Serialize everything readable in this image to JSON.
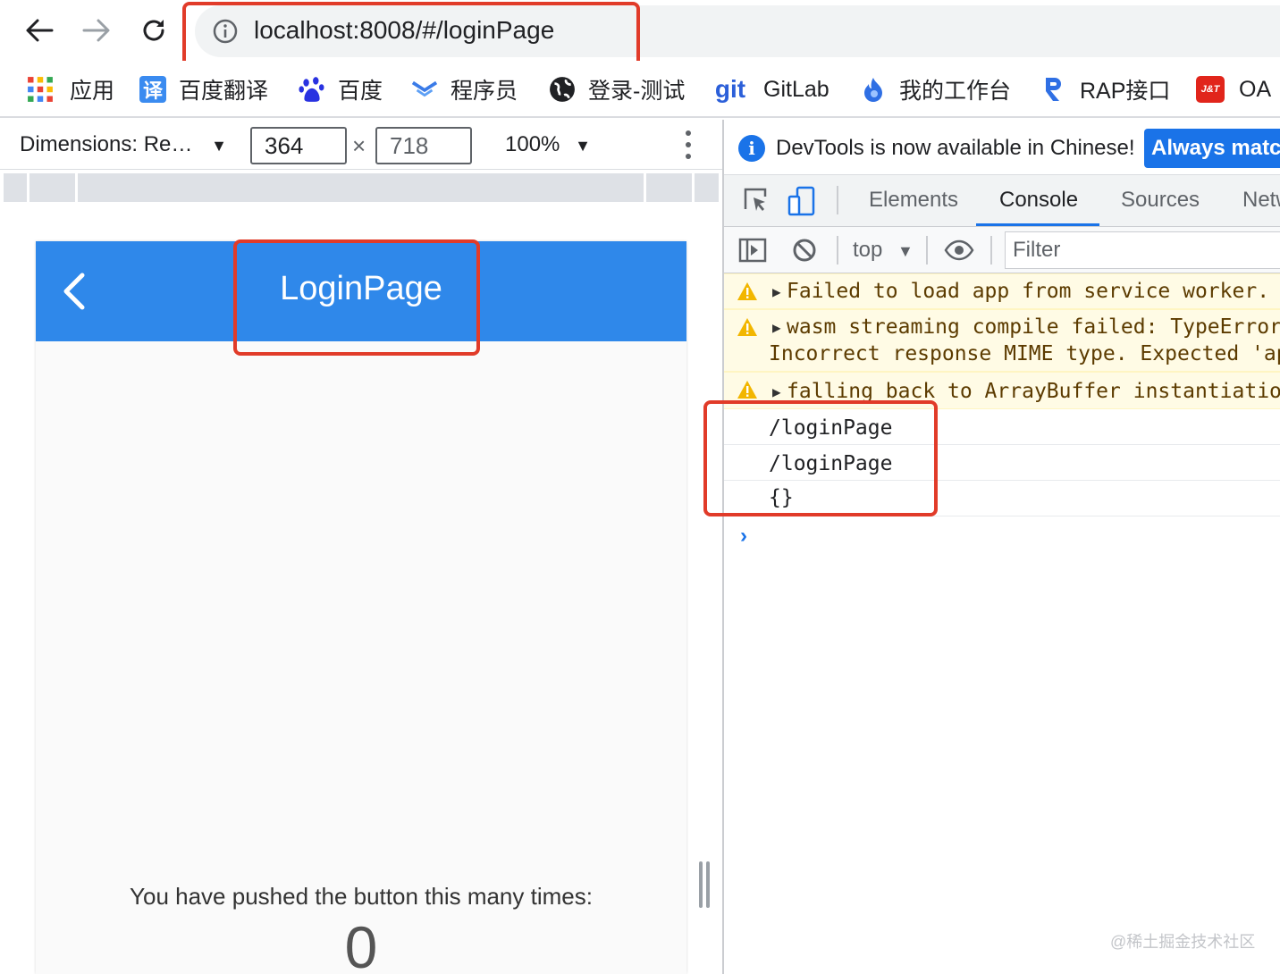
{
  "browser": {
    "url": "localhost:8008/#/loginPage"
  },
  "bookmarks": [
    {
      "label": "应用",
      "icon": "apps-grid-icon"
    },
    {
      "label": "百度翻译",
      "icon": "baidu-translate-icon"
    },
    {
      "label": "百度",
      "icon": "baidu-paw-icon"
    },
    {
      "label": "程序员",
      "icon": "chevron-logo-icon"
    },
    {
      "label": "登录-测试",
      "icon": "globe-icon"
    },
    {
      "label": "GitLab",
      "icon": "git-logo-icon"
    },
    {
      "label": "我的工作台",
      "icon": "flame-logo-icon"
    },
    {
      "label": "RAP接口",
      "icon": "rap-logo-icon"
    },
    {
      "label": "OA",
      "icon": "jt-logo-icon"
    }
  ],
  "device_toolbar": {
    "dimensions_label": "Dimensions: Re…",
    "width": "364",
    "times": "×",
    "height": "718",
    "zoom": "100%"
  },
  "app": {
    "title": "LoginPage",
    "counter_text": "You have pushed the button this many times:",
    "counter_value": "0",
    "appbar_color": "#2f88ea"
  },
  "devtools": {
    "info_text": "DevTools is now available in Chinese!",
    "info_button": "Always match",
    "tabs": [
      "Elements",
      "Console",
      "Sources",
      "Network"
    ],
    "active_tab": "Console",
    "context": "top",
    "filter_placeholder": "Filter",
    "messages": [
      {
        "level": "warning",
        "text": "Failed to load app from service worker."
      },
      {
        "level": "warning",
        "text": "wasm streaming compile failed: TypeError:",
        "text2": "Incorrect response MIME type. Expected 'application/wasm'."
      },
      {
        "level": "warning",
        "text": "falling back to ArrayBuffer instantiation"
      },
      {
        "level": "log",
        "text": "/loginPage"
      },
      {
        "level": "log",
        "text": "/loginPage"
      },
      {
        "level": "log",
        "text": "{}"
      }
    ],
    "prompt": "›"
  },
  "watermark": "@稀土掘金技术社区",
  "colors": {
    "highlight_box": "#e13b29",
    "devtools_accent": "#1a73e8"
  }
}
